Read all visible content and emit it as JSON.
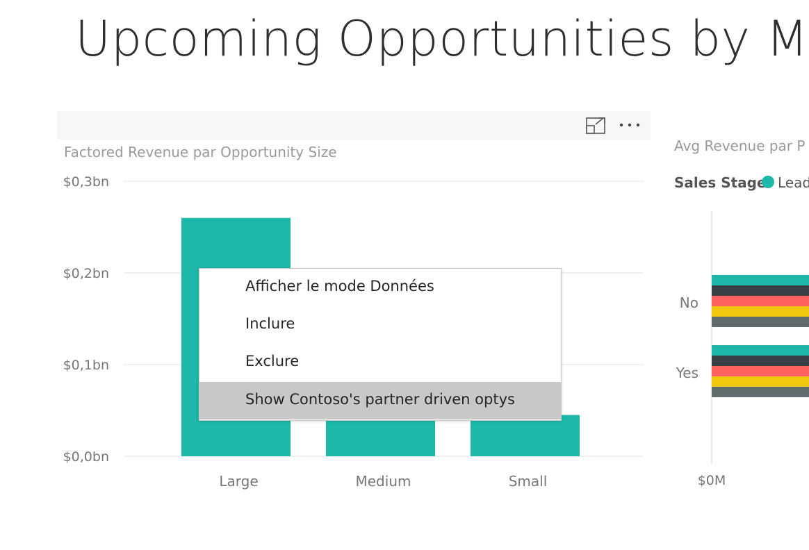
{
  "page": {
    "title": "Upcoming Opportunities by Mo"
  },
  "left_visual": {
    "title": "Factored Revenue par Opportunity Size",
    "header_icons": [
      "focus-mode-icon",
      "more-options-icon"
    ]
  },
  "context_menu": {
    "items": [
      {
        "label": "Afficher le mode Données",
        "highlighted": false
      },
      {
        "label": "Inclure",
        "highlighted": false
      },
      {
        "label": "Exclure",
        "highlighted": false
      },
      {
        "label": "Show Contoso's partner driven optys",
        "highlighted": true
      }
    ]
  },
  "right_visual": {
    "title": "Avg Revenue par P",
    "legend_title": "Sales Stage",
    "legend_first_item": "Lead",
    "legend_first_color": "#1db8a9"
  },
  "chart_data": [
    {
      "type": "bar",
      "categories": [
        "Large",
        "Medium",
        "Small"
      ],
      "values": [
        0.26,
        0.13,
        0.045
      ],
      "ylim": [
        0,
        0.3
      ],
      "yticks": [
        {
          "value": 0.0,
          "label": "$0,0bn"
        },
        {
          "value": 0.1,
          "label": "$0,1bn"
        },
        {
          "value": 0.2,
          "label": "$0,2bn"
        },
        {
          "value": 0.3,
          "label": "$0,3bn"
        }
      ],
      "title": "Factored Revenue par Opportunity Size",
      "color": "#1db8a9",
      "grid": true
    },
    {
      "type": "bar",
      "orientation": "horizontal",
      "categories": [
        "No",
        "Yes"
      ],
      "xtick_label": "$0M",
      "title": "Avg Revenue par P",
      "series_colors": [
        "#1db8a9",
        "#374146",
        "#fd625e",
        "#f2c80f",
        "#5f6b6d"
      ]
    }
  ],
  "colors": {
    "accent": "#1db8a9",
    "menu_highlight": "#c8c8c8",
    "gridline": "#e6e6e6",
    "axis_text": "#777777"
  }
}
